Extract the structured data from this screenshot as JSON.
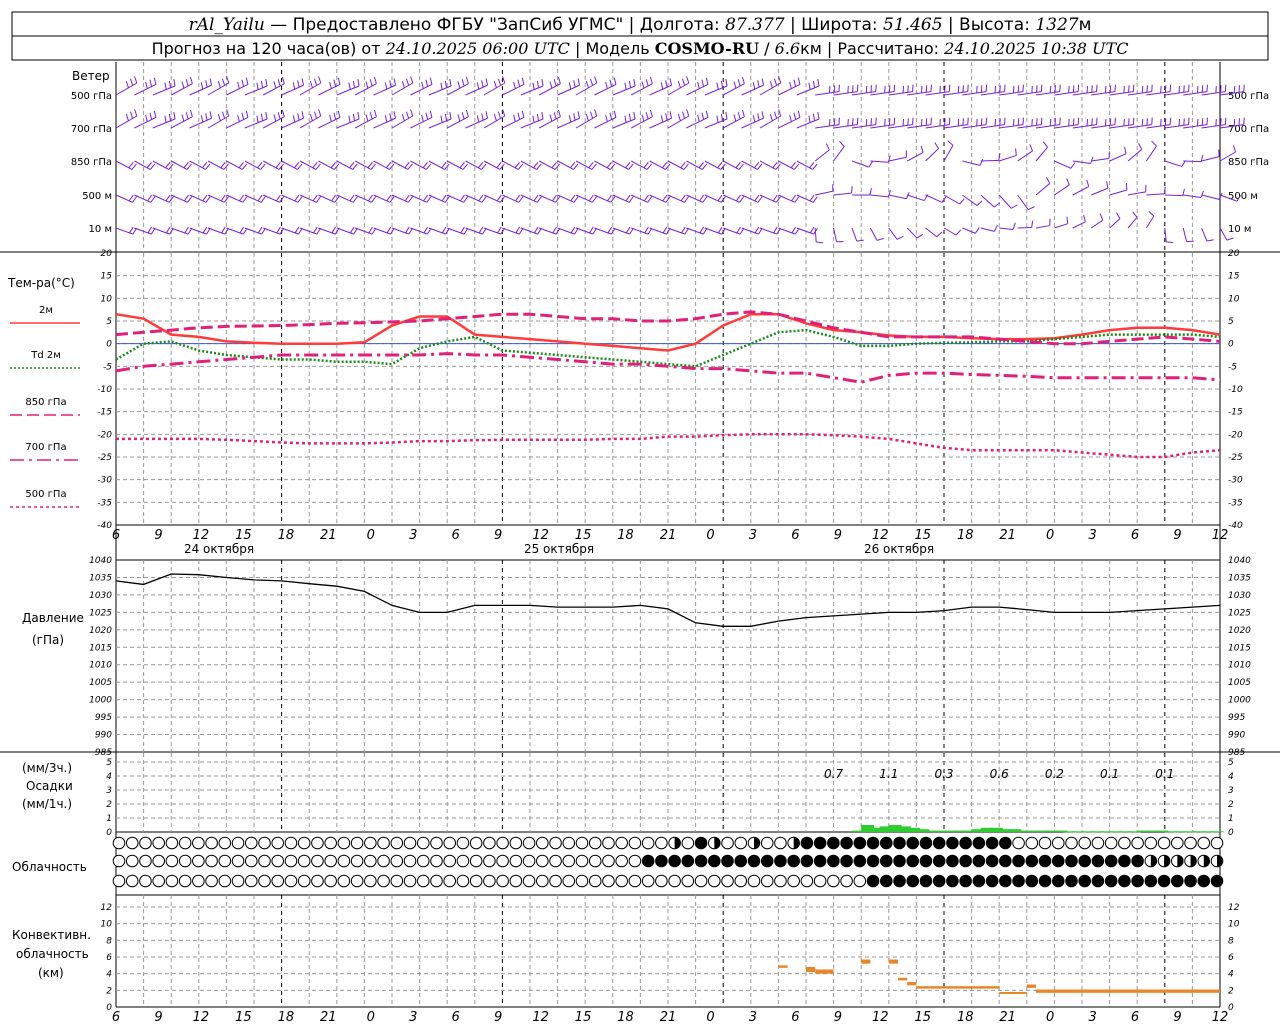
{
  "header": {
    "station": "rAl_Yailu",
    "provider": " — Предоставлено ФГБУ \"ЗапСиб УГМС\" | Долгота: ",
    "lon": "87.377",
    "lat_label": " | Широта: ",
    "lat": "51.465",
    "alt_label": " | Высота: ",
    "alt": "1327",
    "alt_unit": "м",
    "forecast_label": "Прогноз на 120 часа(ов) от ",
    "forecast_time": "24.10.2025 06:00 UTC",
    "model_label": "  | Модель ",
    "model": "COSMO-RU",
    "res_sep": " / ",
    "res": "6.6",
    "res_unit": "км",
    "calc_label": " | Рассчитано: ",
    "calc_time": "24.10.2025 10:38 UTC"
  },
  "wind_panel": {
    "title": "Ветер",
    "levels": [
      "500 гПа",
      "700 гПа",
      "850 гПа",
      "500 м",
      "10  м"
    ],
    "color": "#7a1fd6"
  },
  "temp_panel": {
    "title": "Тем-ра(°C)",
    "legend": [
      {
        "label": "2м",
        "color": "#ff3b3b",
        "style": "solid"
      },
      {
        "label": "Td  2м",
        "color": "#1a8a1a",
        "style": "dotted"
      },
      {
        "label": "850 гПа",
        "color": "#e0207a",
        "style": "dash"
      },
      {
        "label": "700 гПа",
        "color": "#e0207a",
        "style": "dashdot"
      },
      {
        "label": "500 гПа",
        "color": "#e0207a",
        "style": "dot"
      }
    ],
    "yticks": [
      "20",
      "15",
      "10",
      "5",
      "0",
      "-5",
      "-10",
      "-15",
      "-20",
      "-25",
      "-30",
      "-35",
      "-40"
    ]
  },
  "x_axis": {
    "ticks": [
      "6",
      "9",
      "12",
      "15",
      "18",
      "21",
      "0",
      "3",
      "6",
      "9",
      "12",
      "15",
      "18",
      "21",
      "0",
      "3",
      "6",
      "9",
      "12",
      "15",
      "18",
      "21",
      "0",
      "3",
      "6",
      "9",
      "12"
    ],
    "dates": [
      "24 октября",
      "25 октября",
      "26 октября"
    ]
  },
  "pressure_panel": {
    "title": "Давление",
    "unit": "(гПа)",
    "yticks": [
      "1040",
      "1035",
      "1030",
      "1025",
      "1020",
      "1015",
      "1010",
      "1005",
      "1000",
      "995",
      "990",
      "985"
    ]
  },
  "precip_panel": {
    "unit_3h": "(мм/3ч.)",
    "title": "Осадки",
    "unit_1h": "(мм/1ч.)",
    "yticks": [
      "5",
      "4",
      "3",
      "2",
      "1",
      "0"
    ],
    "sums_3h": [
      "0.7",
      "1.1",
      "0.3",
      "0.6",
      "0.2",
      "0.1",
      "0.1"
    ],
    "bar_color": "#2ecc2e"
  },
  "cloud_panel": {
    "title": "Облачность"
  },
  "conv_panel": {
    "title_1": "Конвективн.",
    "title_2": "облачность",
    "unit": "(км)",
    "yticks": [
      "12",
      "10",
      "8",
      "6",
      "4",
      "2",
      "0"
    ],
    "color": "#e8862a"
  },
  "chart_data": [
    {
      "type": "line",
      "title": "Тем-ра(°C)",
      "x_hours": [
        0,
        3,
        6,
        9,
        12,
        15,
        18,
        21,
        24,
        27,
        30,
        33,
        36,
        39,
        42,
        45,
        48,
        51,
        54,
        57,
        60,
        63,
        66,
        69,
        72,
        75,
        78,
        81,
        84,
        87,
        90,
        93,
        96,
        99,
        102,
        105,
        108,
        111,
        114,
        117,
        120
      ],
      "ylim": [
        -40,
        20
      ],
      "series": [
        {
          "name": "2м",
          "values": [
            6.5,
            5.5,
            2,
            1.5,
            0.5,
            0.2,
            0,
            0,
            0,
            0.3,
            4,
            6,
            6,
            2,
            1.5,
            1,
            0.5,
            0,
            -0.5,
            -1,
            -1.5,
            0,
            4,
            6.5,
            6.5,
            4.5,
            3,
            2.5,
            1.8,
            1.5,
            1.5,
            1.2,
            1,
            1,
            1.2,
            2,
            3,
            3.5,
            3.5,
            3,
            2
          ]
        },
        {
          "name": "Td  2м",
          "values": [
            -3.5,
            0,
            0.5,
            -1.5,
            -2.5,
            -3,
            -3.5,
            -3.5,
            -4,
            -4,
            -4.5,
            -1,
            0.5,
            1.5,
            -1.5,
            -2,
            -2.5,
            -3,
            -3.5,
            -4,
            -4.5,
            -5,
            -2.5,
            0,
            2.5,
            3,
            1.5,
            -0.5,
            -0.5,
            0,
            0.2,
            0.3,
            0.5,
            0.5,
            1,
            1.5,
            2,
            2,
            2,
            2,
            1.5
          ]
        },
        {
          "name": "850 гПа",
          "values": [
            2,
            2.5,
            3,
            3.5,
            3.8,
            3.9,
            4,
            4.2,
            4.5,
            4.6,
            4.8,
            5,
            5.5,
            6,
            6.5,
            6.5,
            6,
            5.5,
            5.5,
            5,
            5,
            5.5,
            6.5,
            7,
            6.5,
            5,
            3.5,
            2.5,
            1.5,
            1.5,
            1.5,
            1.5,
            1,
            0.5,
            0,
            0,
            0.5,
            1,
            1.5,
            1,
            0.5
          ]
        },
        {
          "name": "700 гПа",
          "values": [
            -6,
            -5,
            -4.5,
            -4,
            -3.5,
            -3,
            -2.5,
            -2.5,
            -2.5,
            -2.5,
            -2.5,
            -2.5,
            -2.2,
            -2.5,
            -2.5,
            -3,
            -3.5,
            -4,
            -4.5,
            -4.5,
            -5,
            -5.5,
            -5.5,
            -6,
            -6.5,
            -6.5,
            -7.5,
            -8.5,
            -7,
            -6.5,
            -6.5,
            -6.8,
            -7,
            -7.2,
            -7.5,
            -7.5,
            -7.5,
            -7.5,
            -7.5,
            -7.5,
            -8
          ]
        },
        {
          "name": "500 гПа",
          "values": [
            -21,
            -21,
            -21,
            -21,
            -21.2,
            -21.5,
            -21.8,
            -22,
            -22,
            -22,
            -21.8,
            -21.5,
            -21.5,
            -21.3,
            -21.2,
            -21.2,
            -21.2,
            -21.2,
            -21,
            -21,
            -20.5,
            -20.5,
            -20.2,
            -20,
            -20,
            -20,
            -20.2,
            -20.5,
            -21,
            -22,
            -23,
            -23.5,
            -23.5,
            -23.5,
            -23.5,
            -24,
            -24.5,
            -25,
            -25,
            -24,
            -23.5
          ]
        }
      ]
    },
    {
      "type": "line",
      "title": "Давление",
      "x_hours": [
        0,
        3,
        6,
        9,
        12,
        15,
        18,
        21,
        24,
        27,
        30,
        33,
        36,
        39,
        42,
        45,
        48,
        51,
        54,
        57,
        60,
        63,
        66,
        69,
        72,
        75,
        78,
        81,
        84,
        87,
        90,
        93,
        96,
        99,
        102,
        105,
        108,
        111,
        114,
        117,
        120
      ],
      "ylim": [
        985,
        1040
      ],
      "series": [
        {
          "name": "Давление",
          "values": [
            1034,
            1033,
            1036,
            1035.8,
            1035,
            1034.3,
            1034,
            1033.2,
            1032.5,
            1031,
            1027,
            1025,
            1025,
            1027,
            1027,
            1027,
            1026.5,
            1026.5,
            1026.5,
            1027,
            1026,
            1022,
            1021,
            1021,
            1022.5,
            1023.5,
            1024,
            1024.5,
            1025,
            1025,
            1025.5,
            1026.5,
            1026.5,
            1025.8,
            1025,
            1025,
            1025,
            1025.5,
            1026,
            1026.5,
            1027
          ]
        }
      ]
    },
    {
      "type": "bar",
      "title": "Осадки",
      "x_hours": [
        81,
        82,
        83,
        84,
        85,
        86,
        87,
        88,
        89,
        90,
        91,
        92,
        93,
        94,
        95,
        96,
        97,
        98,
        99,
        100,
        101,
        102,
        103,
        104,
        105,
        106,
        107,
        108,
        109,
        110,
        111,
        112,
        113,
        114,
        115,
        116,
        117,
        118,
        119,
        120
      ],
      "ylim": [
        0,
        5
      ],
      "series": [
        {
          "name": "мм/1ч",
          "values": [
            0.1,
            0.5,
            0.3,
            0.4,
            0.5,
            0.4,
            0.3,
            0.2,
            0.1,
            0.1,
            0.1,
            0.1,
            0.1,
            0.2,
            0.3,
            0.3,
            0.2,
            0.2,
            0.1,
            0.1,
            0.1,
            0.1,
            0.1,
            0.05,
            0.05,
            0.05,
            0.05,
            0.05,
            0.05,
            0.05,
            0.05,
            0.1,
            0.1,
            0.1,
            0.05,
            0.05,
            0.05,
            0.05,
            0.05,
            0.05
          ]
        }
      ]
    },
    {
      "type": "bar",
      "title": "Конвективн. облачность",
      "ylim": [
        0,
        13
      ],
      "segments": [
        {
          "x_from": 72,
          "x_to": 73,
          "top": 5,
          "bottom": 4.7
        },
        {
          "x_from": 75,
          "x_to": 76,
          "top": 4.8,
          "bottom": 4.2
        },
        {
          "x_from": 76,
          "x_to": 78,
          "top": 4.5,
          "bottom": 4
        },
        {
          "x_from": 81,
          "x_to": 82,
          "top": 5.7,
          "bottom": 5.2
        },
        {
          "x_from": 84,
          "x_to": 85,
          "top": 5.7,
          "bottom": 5.2
        },
        {
          "x_from": 85,
          "x_to": 86,
          "top": 3.5,
          "bottom": 3.2
        },
        {
          "x_from": 86,
          "x_to": 87,
          "top": 3,
          "bottom": 2.6
        },
        {
          "x_from": 87,
          "x_to": 96,
          "top": 2.5,
          "bottom": 2.2
        },
        {
          "x_from": 96,
          "x_to": 99,
          "top": 1.8,
          "bottom": 1.7
        },
        {
          "x_from": 99,
          "x_to": 100,
          "top": 2.7,
          "bottom": 2.3
        },
        {
          "x_from": 100,
          "x_to": 120,
          "top": 2.1,
          "bottom": 1.7
        }
      ]
    }
  ]
}
